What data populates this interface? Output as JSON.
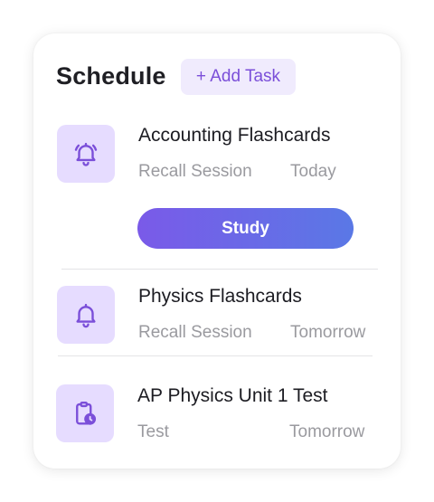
{
  "header": {
    "title": "Schedule",
    "add_task_label": "+ Add Task"
  },
  "tasks": [
    {
      "title": "Accounting Flashcards",
      "type": "Recall Session",
      "when": "Today",
      "icon": "bell-ringing-icon",
      "action_label": "Study"
    },
    {
      "title": "Physics Flashcards",
      "type": "Recall Session",
      "when": "Tomorrow",
      "icon": "bell-icon"
    },
    {
      "title": "AP Physics Unit 1 Test",
      "type": "Test",
      "when": "Tomorrow",
      "icon": "clipboard-clock-icon"
    }
  ],
  "colors": {
    "accent": "#7b4fd9",
    "icon_bg": "#e6dcff",
    "add_task_bg": "#f0ebfd",
    "button_gradient_start": "#7a5ae8",
    "button_gradient_end": "#5a78e6",
    "muted_text": "#9a9a9f"
  }
}
